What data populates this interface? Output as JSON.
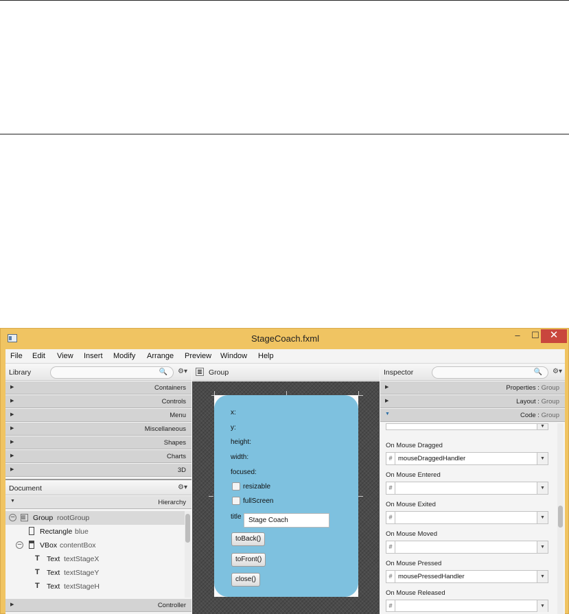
{
  "window": {
    "title": "StageCoach.fxml",
    "min": "–",
    "max": "☐",
    "close": "✕"
  },
  "menu": [
    "File",
    "Edit",
    "View",
    "Insert",
    "Modify",
    "Arrange",
    "Preview",
    "Window",
    "Help"
  ],
  "library": {
    "title": "Library",
    "sections": [
      "Containers",
      "Controls",
      "Menu",
      "Miscellaneous",
      "Shapes",
      "Charts",
      "3D"
    ]
  },
  "document": {
    "title": "Document",
    "hierarchy_label": "Hierarchy",
    "controller_label": "Controller",
    "tree": [
      {
        "type": "Group",
        "id": "rootGroup"
      },
      {
        "type": "Rectangle",
        "id": "blue"
      },
      {
        "type": "VBox",
        "id": "contentBox"
      },
      {
        "type": "Text",
        "id": "textStageX"
      },
      {
        "type": "Text",
        "id": "textStageY"
      },
      {
        "type": "Text",
        "id": "textStageH"
      }
    ]
  },
  "canvas": {
    "crumb": "Group",
    "labels": [
      "x:",
      "y:",
      "height:",
      "width:",
      "focused:"
    ],
    "checkboxes": [
      "resizable",
      "fullScreen"
    ],
    "title_label": "title",
    "title_value": "Stage Coach",
    "buttons": [
      "toBack()",
      "toFront()",
      "close()"
    ]
  },
  "inspector": {
    "title": "Inspector",
    "sections": [
      {
        "name": "Properties",
        "target": "Group"
      },
      {
        "name": "Layout",
        "target": "Group"
      },
      {
        "name": "Code",
        "target": "Group"
      }
    ],
    "events": [
      {
        "label": "On Mouse Dragged",
        "value": "mouseDraggedHandler"
      },
      {
        "label": "On Mouse Entered",
        "value": ""
      },
      {
        "label": "On Mouse Exited",
        "value": ""
      },
      {
        "label": "On Mouse Moved",
        "value": ""
      },
      {
        "label": "On Mouse Pressed",
        "value": "mousePressedHandler"
      },
      {
        "label": "On Mouse Released",
        "value": ""
      }
    ],
    "hash": "#"
  },
  "icons": {
    "search": "search-icon",
    "gear": "gear-icon"
  }
}
